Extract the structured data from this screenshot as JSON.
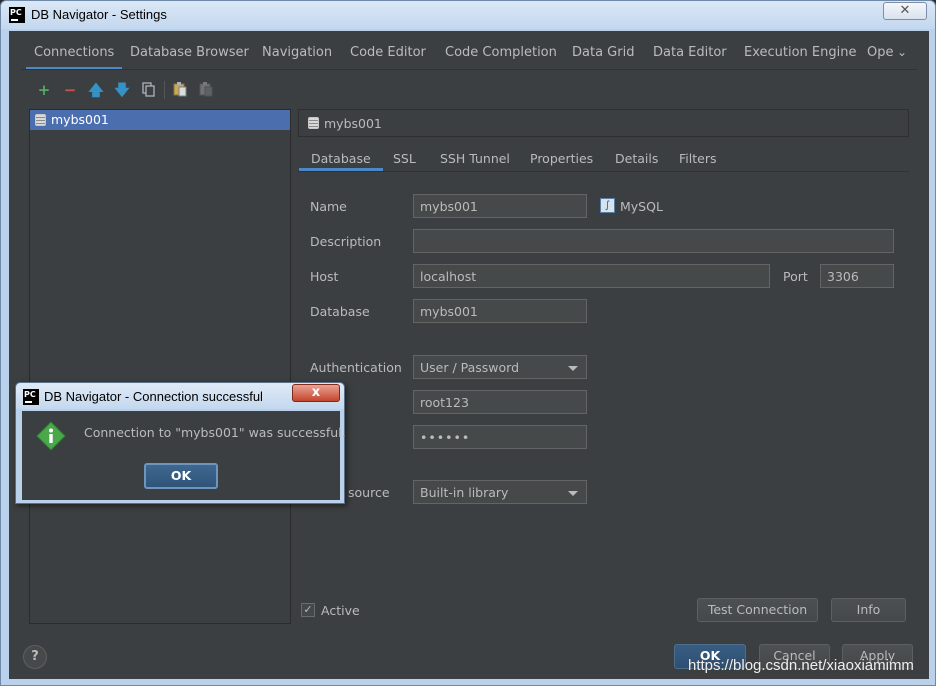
{
  "window": {
    "title": "DB Navigator - Settings",
    "app_icon_text": "PC"
  },
  "top_tabs": [
    "Connections",
    "Database Browser",
    "Navigation",
    "Code Editor",
    "Code Completion",
    "Data Grid",
    "Data Editor",
    "Execution Engine",
    "Ope"
  ],
  "top_tabs_active": "Connections",
  "toolbar": {
    "icons": [
      "add-icon",
      "remove-icon",
      "move-up-icon",
      "move-down-icon",
      "duplicate-icon",
      "copy-icon",
      "paste-icon"
    ]
  },
  "connections": [
    {
      "name": "mybs001",
      "selected": true
    }
  ],
  "connection_header": "mybs001",
  "sub_tabs": [
    "Database",
    "SSL",
    "SSH Tunnel",
    "Properties",
    "Details",
    "Filters"
  ],
  "sub_tabs_active": "Database",
  "form": {
    "name_label": "Name",
    "name_value": "mybs001",
    "db_type": "MySQL",
    "description_label": "Description",
    "description_value": "",
    "host_label": "Host",
    "host_value": "localhost",
    "port_label": "Port",
    "port_value": "3306",
    "database_label": "Database",
    "database_value": "mybs001",
    "auth_label": "Authentication",
    "auth_value": "User / Password",
    "user_value": "root123",
    "password_label_partial": "ord",
    "password_value": "••••••",
    "driver_label_partial": "source",
    "driver_value": "Built-in library"
  },
  "active_label": "Active",
  "active_checked": true,
  "buttons": {
    "test_connection": "Test Connection",
    "info": "Info",
    "ok": "OK",
    "cancel": "Cancel",
    "apply": "Apply",
    "help": "?"
  },
  "dialog": {
    "title": "DB Navigator - Connection successful",
    "message": "Connection to \"mybs001\" was successful.",
    "ok": "OK",
    "close": "x"
  },
  "watermark": "https://blog.csdn.net/xiaoxiamimm",
  "colors": {
    "accent": "#4a88c7",
    "selection": "#4b6eaf",
    "panel": "#3c3f41",
    "add": "#59a869",
    "remove": "#c75450",
    "arrow": "#3592c4"
  }
}
